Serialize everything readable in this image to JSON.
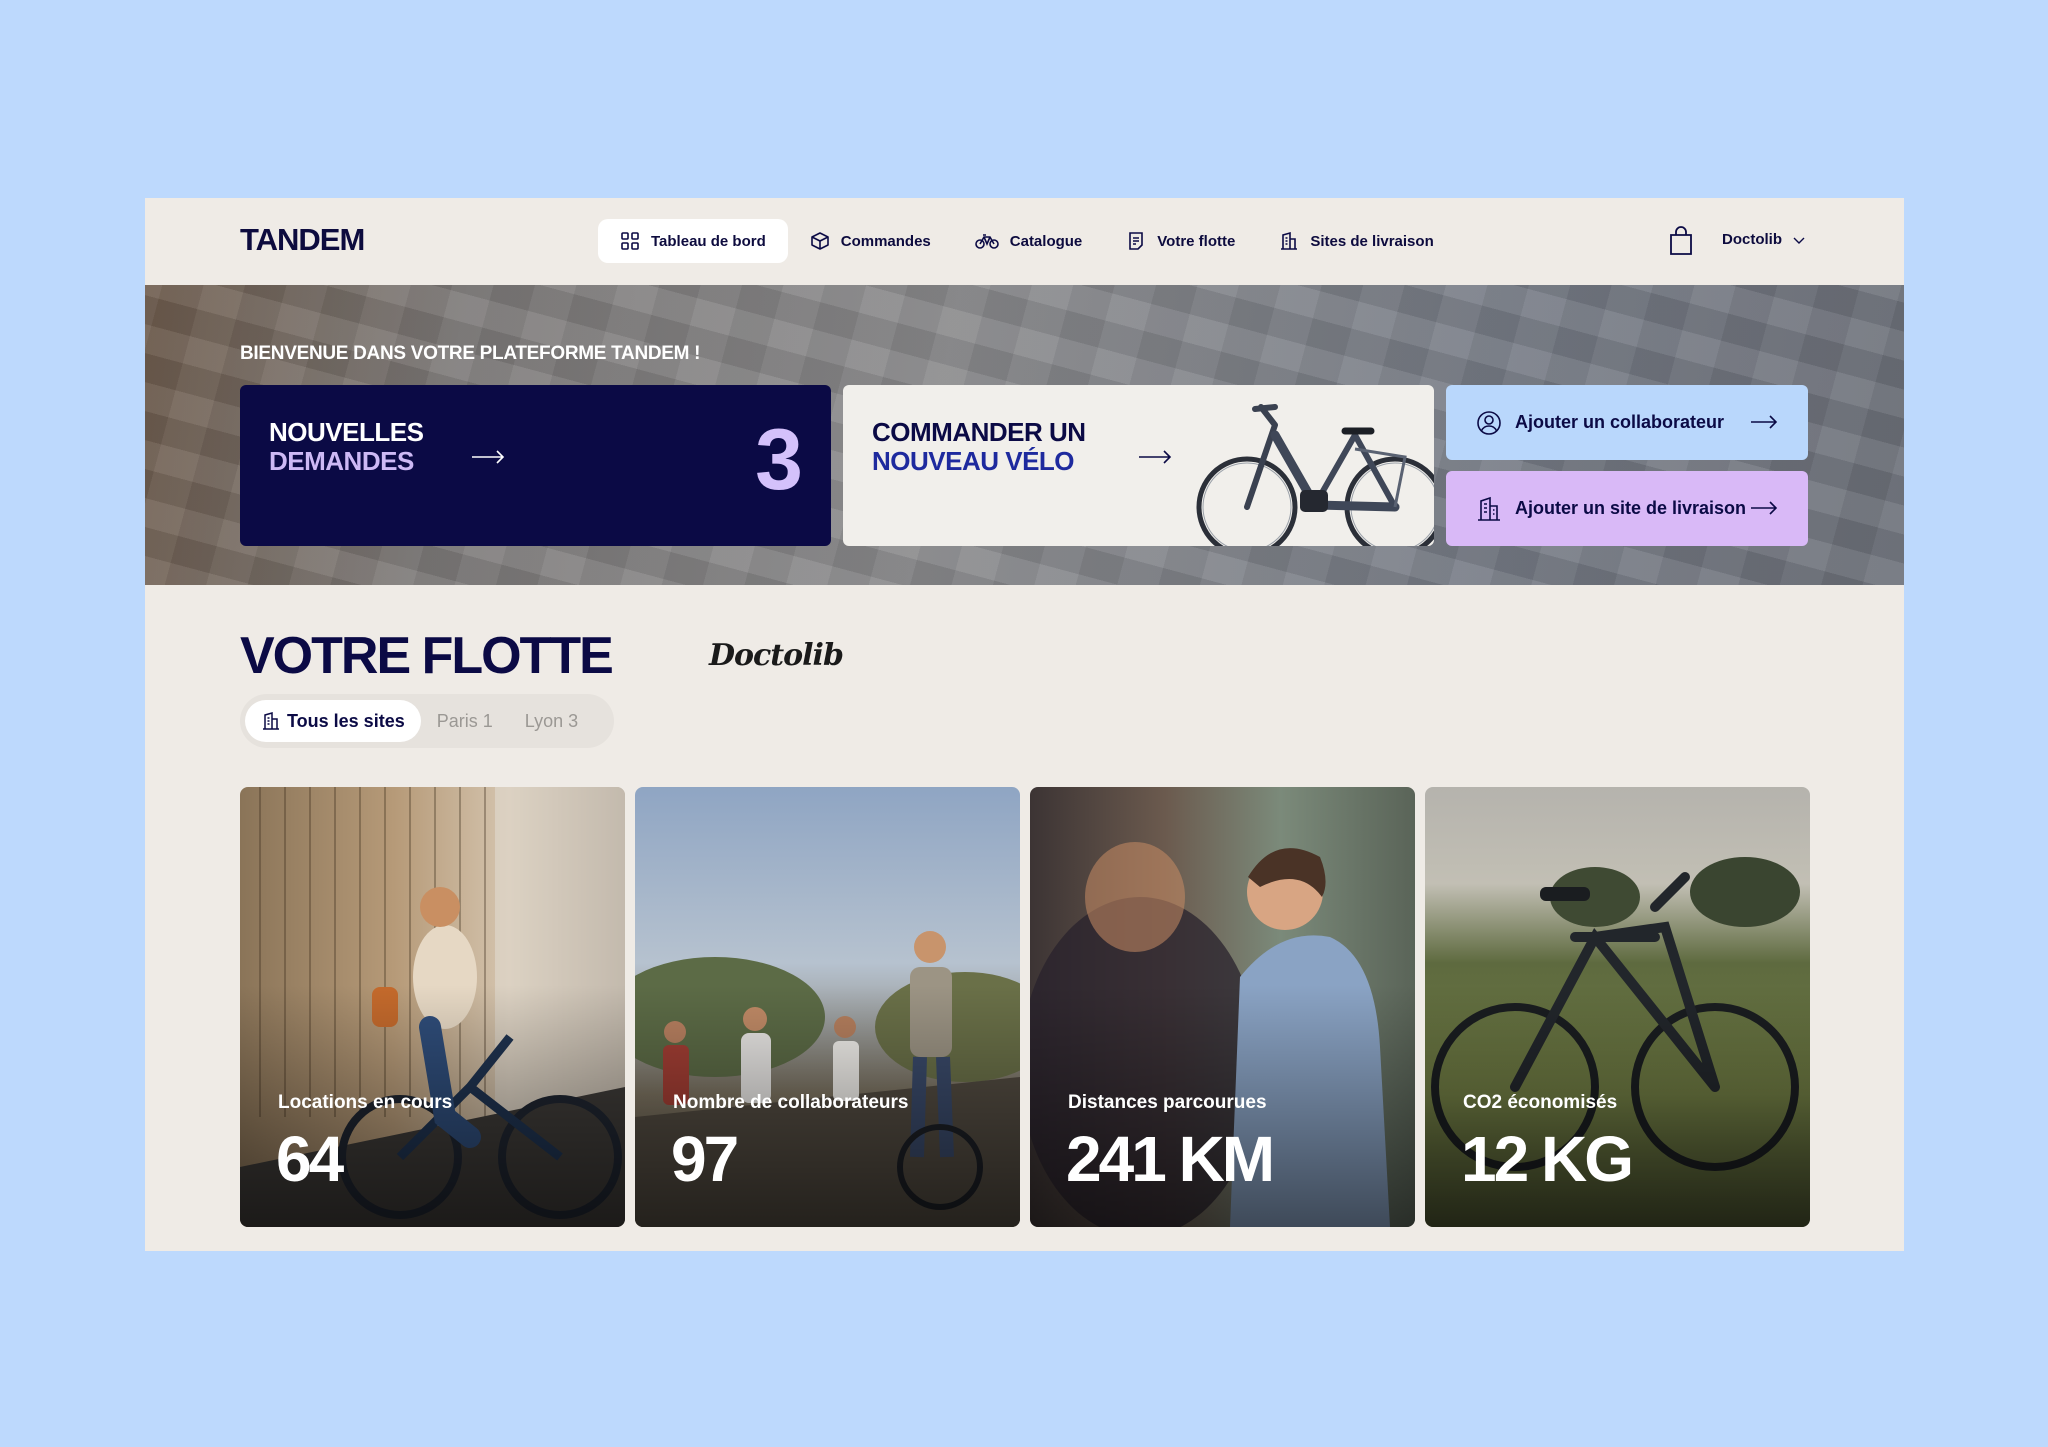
{
  "brand": "TANDEM",
  "nav": [
    {
      "label": "Tableau de bord",
      "icon": "grid-icon",
      "active": true
    },
    {
      "label": "Commandes",
      "icon": "box-icon",
      "active": false
    },
    {
      "label": "Catalogue",
      "icon": "bike-icon",
      "active": false
    },
    {
      "label": "Votre flotte",
      "icon": "document-icon",
      "active": false
    },
    {
      "label": "Sites de livraison",
      "icon": "building-icon",
      "active": false
    }
  ],
  "account": {
    "name": "Doctolib",
    "cart_icon": "shopping-bag-icon",
    "chevron": "chevron-down-icon"
  },
  "hero": {
    "welcome": "BIENVENUE DANS VOTRE PLATEFORME TANDEM !",
    "demandes": {
      "line1": "NOUVELLES",
      "line2": "DEMANDES",
      "count": "3"
    },
    "commander": {
      "line1": "COMMANDER UN",
      "line2": "NOUVEAU VÉLO"
    },
    "add_collab": "Ajouter un collaborateur",
    "add_site": "Ajouter un site de livraison"
  },
  "flotte": {
    "title": "VOTRE FLOTTE",
    "company": "Doctolib",
    "filters": [
      {
        "label": "Tous les sites",
        "active": true
      },
      {
        "label": "Paris 1",
        "active": false
      },
      {
        "label": "Lyon 3",
        "active": false
      }
    ],
    "stats": [
      {
        "label": "Locations en cours",
        "value": "64"
      },
      {
        "label": "Nombre de collaborateurs",
        "value": "97"
      },
      {
        "label": "Distances parcourues",
        "value": "241 KM"
      },
      {
        "label": "CO2 économisés",
        "value": "12 KG"
      }
    ]
  },
  "colors": {
    "background": "#bdd9fd",
    "panel": "#efebe6",
    "navy": "#0b0a45",
    "lavender": "#d4c1fb",
    "light_blue_button": "#b9d7fc",
    "purple_button": "#d9b9f7"
  }
}
